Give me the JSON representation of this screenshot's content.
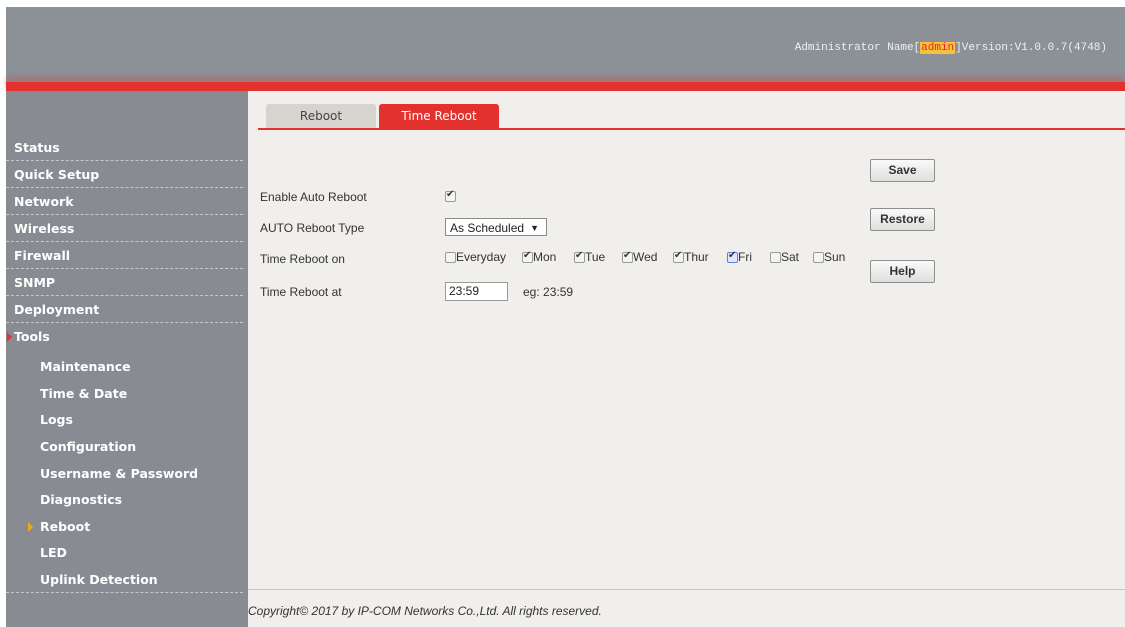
{
  "header": {
    "admin_prefix": "Administrator Name[",
    "admin_name": "admin",
    "version_text": "]Version:V1.0.0.7(4748)"
  },
  "sidebar": {
    "items": [
      {
        "label": "Status"
      },
      {
        "label": "Quick Setup"
      },
      {
        "label": "Network"
      },
      {
        "label": "Wireless"
      },
      {
        "label": "Firewall"
      },
      {
        "label": "SNMP"
      },
      {
        "label": "Deployment"
      },
      {
        "label": "Tools",
        "active": true
      }
    ],
    "sub_items": [
      {
        "label": "Maintenance"
      },
      {
        "label": "Time & Date"
      },
      {
        "label": "Logs"
      },
      {
        "label": "Configuration"
      },
      {
        "label": "Username & Password"
      },
      {
        "label": "Diagnostics"
      },
      {
        "label": "Reboot",
        "active": true
      },
      {
        "label": "LED"
      },
      {
        "label": "Uplink Detection"
      }
    ]
  },
  "tabs": [
    {
      "label": "Reboot",
      "active": false
    },
    {
      "label": "Time Reboot",
      "active": true
    }
  ],
  "form": {
    "enable_label": "Enable Auto Reboot",
    "enable_checked": true,
    "type_label": "AUTO Reboot Type",
    "type_value": "As Scheduled",
    "on_label": "Time Reboot on",
    "days": [
      {
        "label": "Everyday",
        "checked": false
      },
      {
        "label": "Mon",
        "checked": true
      },
      {
        "label": "Tue",
        "checked": true
      },
      {
        "label": "Wed",
        "checked": true
      },
      {
        "label": "Thur",
        "checked": true
      },
      {
        "label": "Fri",
        "checked": true
      },
      {
        "label": "Sat",
        "checked": false
      },
      {
        "label": "Sun",
        "checked": false
      }
    ],
    "at_label": "Time Reboot at",
    "time_value": "23:59",
    "time_hint": "eg: 23:59"
  },
  "buttons": {
    "save": "Save",
    "restore": "Restore",
    "help": "Help"
  },
  "footer": {
    "copyright": "Copyright© 2017 by IP-COM Networks Co.,Ltd. All rights reserved."
  },
  "colors": {
    "accent": "#e3312e",
    "sidebar": "#888c92",
    "header": "#8c9097",
    "content_bg": "#f1efec"
  }
}
